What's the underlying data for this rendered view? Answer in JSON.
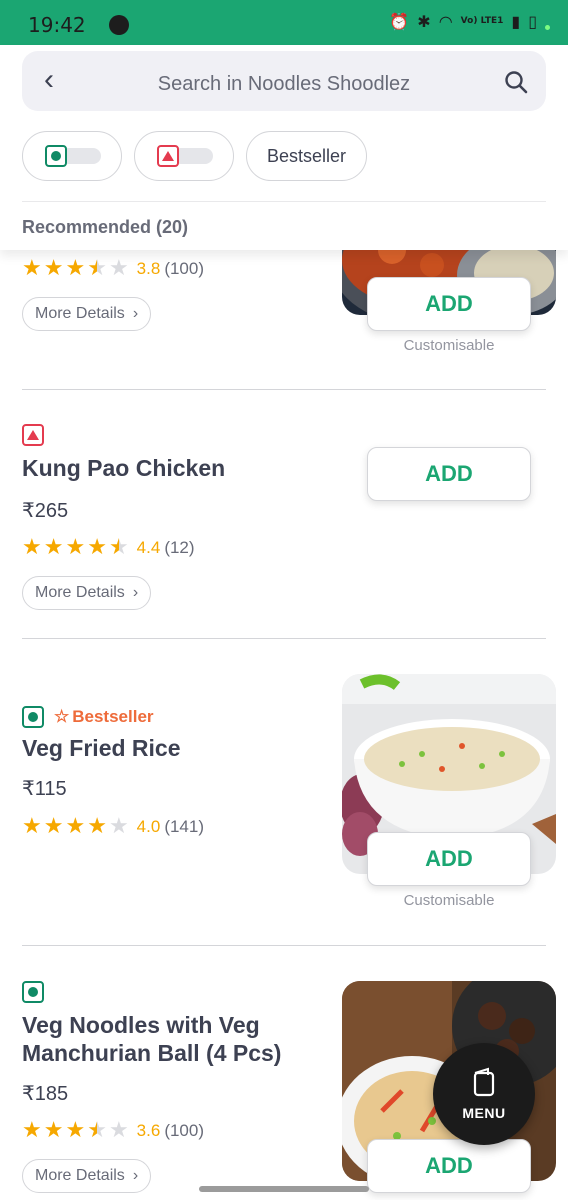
{
  "status_bar": {
    "time": "19:42",
    "network": "Vo) LTE1"
  },
  "search": {
    "placeholder": "Search in Noodles Shoodlez"
  },
  "filters": {
    "bestseller_label": "Bestseller"
  },
  "section": {
    "title": "Recommended (20)"
  },
  "items": [
    {
      "name": "",
      "price": "",
      "rating": "3.8",
      "rating_count": "(100)",
      "stars": 3.5,
      "more_details": "More Details",
      "add_label": "ADD",
      "customisable": "Customisable",
      "image": "chicken-curry-dish"
    },
    {
      "name": "Kung Pao Chicken",
      "price": "₹265",
      "rating": "4.4",
      "rating_count": "(12)",
      "stars": 4.5,
      "type": "non-veg",
      "more_details": "More Details",
      "add_label": "ADD"
    },
    {
      "name": "Veg Fried Rice",
      "price": "₹115",
      "rating": "4.0",
      "rating_count": "(141)",
      "stars": 4,
      "type": "veg",
      "badge": "Bestseller",
      "add_label": "ADD",
      "customisable": "Customisable",
      "image": "fried-rice-bowl"
    },
    {
      "name": "Veg Noodles with Veg Manchurian Ball (4 Pcs)",
      "price": "₹185",
      "rating": "3.6",
      "rating_count": "(100)",
      "stars": 3.5,
      "type": "veg",
      "more_details": "More Details",
      "add_label": "ADD",
      "image": "noodles-manchurian-plate"
    }
  ],
  "fab": {
    "label": "MENU"
  },
  "colors": {
    "brand": "#1ba672",
    "rating": "#f6a800",
    "veg": "#0f8a65",
    "nonveg": "#e43b4f",
    "bestseller": "#ee6b3a"
  }
}
